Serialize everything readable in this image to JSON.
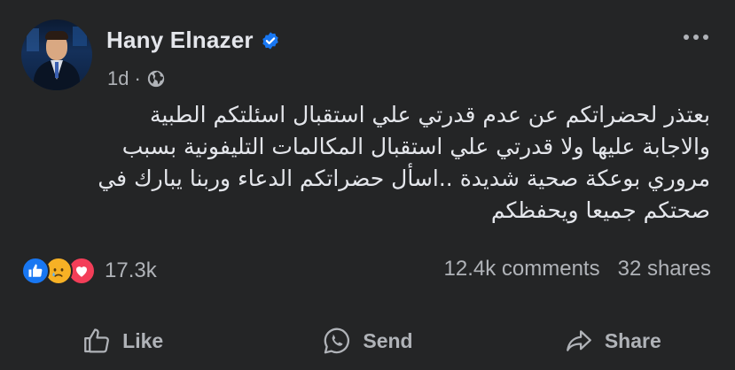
{
  "post": {
    "author_name": "Hany Elnazer",
    "time": "1d",
    "separator": "·",
    "body_lines": [
      "بعتذر لحضراتكم عن عدم قدرتي علي استقبال اسئلتكم الطبية",
      "والاجابة عليها ولا قدرتي علي استقبال المكالمات التليفونية بسبب",
      "مروري بوعكة صحية شديدة ..اسأل حضراتكم الدعاء وربنا يبارك في",
      "صحتكم جميعا ويحفظكم"
    ],
    "reaction_count": "17.3k",
    "comments": "12.4k comments",
    "shares": "32 shares"
  },
  "actions": {
    "like_label": "Like",
    "send_label": "Send",
    "share_label": "Share"
  },
  "icons": {
    "verified": "verified-badge-icon",
    "privacy": "globe-icon",
    "more": "more-options-icon",
    "reactions": [
      "like-reaction-icon",
      "sad-reaction-icon",
      "love-reaction-icon"
    ]
  },
  "colors": {
    "background": "#242526",
    "text_primary": "#e4e6eb",
    "text_secondary": "#b0b3b8",
    "verified_blue": "#1877f2",
    "like_blue": "#1877f2",
    "love_red": "#f33e58",
    "sad_yellow": "#f7b125"
  }
}
